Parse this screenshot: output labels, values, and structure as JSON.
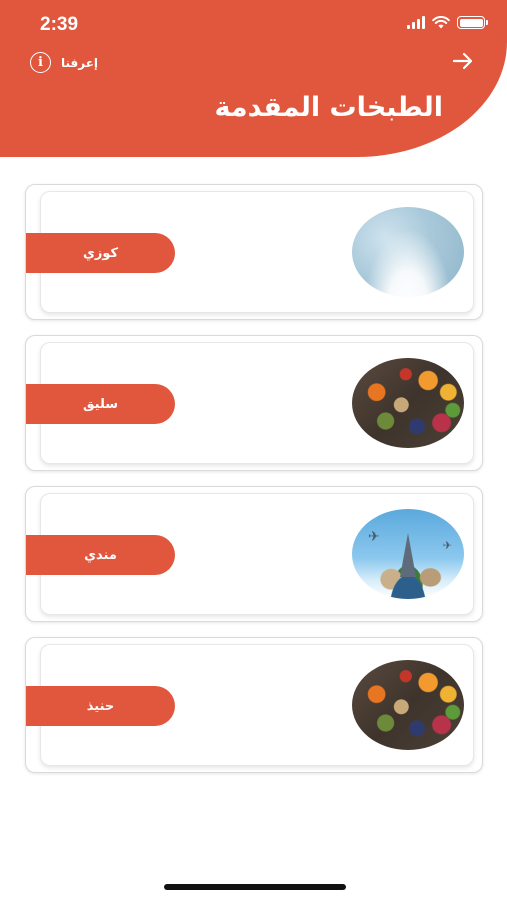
{
  "status_bar": {
    "time": "2:39"
  },
  "header": {
    "about_label": "إعرفنا",
    "title": "الطبخات المقدمة"
  },
  "cards": [
    {
      "label": "كوزي",
      "image": "cozy-winter-image"
    },
    {
      "label": "سليق",
      "image": "food-ingredients-image"
    },
    {
      "label": "مندي",
      "image": "travel-landmarks-image"
    },
    {
      "label": "حنيذ",
      "image": "food-ingredients-image"
    }
  ],
  "colors": {
    "accent": "#e0573d",
    "background": "#ffffff"
  },
  "icons": {
    "about": "info-icon",
    "back": "arrow-right-icon",
    "signal": "signal-icon",
    "wifi": "wifi-icon",
    "battery": "battery-icon"
  }
}
